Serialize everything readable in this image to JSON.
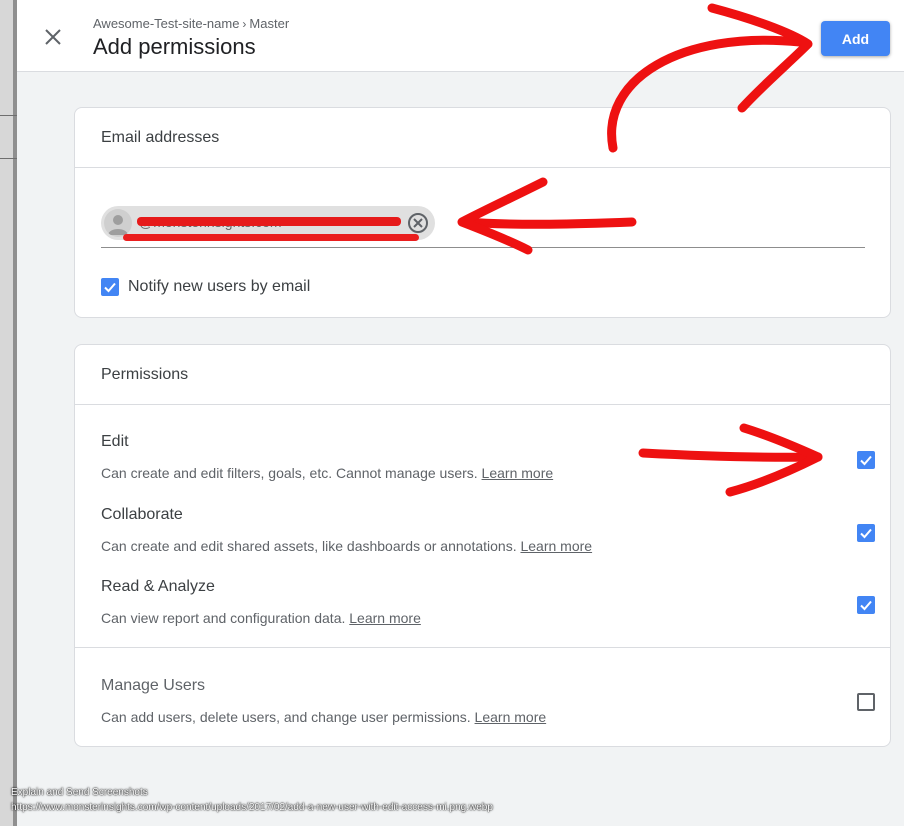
{
  "header": {
    "breadcrumb_site": "Awesome-Test-site-name",
    "breadcrumb_separator": "›",
    "breadcrumb_view": "Master",
    "title": "Add permissions",
    "add_label": "Add"
  },
  "email_card": {
    "title": "Email addresses",
    "chip_text": "@monsterinsights.com",
    "notify_label": "Notify new users by email",
    "notify_checked": true
  },
  "permissions_card": {
    "title": "Permissions",
    "learn_more": "Learn more",
    "items": [
      {
        "name": "Edit",
        "description": "Can create and edit filters, goals, etc. Cannot manage users.",
        "checked": true
      },
      {
        "name": "Collaborate",
        "description": "Can create and edit shared assets, like dashboards or annotations.",
        "checked": true
      },
      {
        "name": "Read & Analyze",
        "description": "Can view report and configuration data.",
        "checked": true
      },
      {
        "name": "Manage Users",
        "description": "Can add users, delete users, and change user permissions.",
        "checked": false
      }
    ]
  },
  "footer": {
    "line1": "Explain and Send Screenshots",
    "line2": "https://www.monsterinsights.com/wp-content/uploads/2017/02/add-a-new-user-with-edit-access-mi.png.webp"
  },
  "colors": {
    "accent": "#4285f4",
    "annotation_red": "#ee1111"
  },
  "icons": {
    "close": "close-icon",
    "avatar": "person-icon",
    "remove": "cancel-circle-icon",
    "check": "check-icon"
  }
}
